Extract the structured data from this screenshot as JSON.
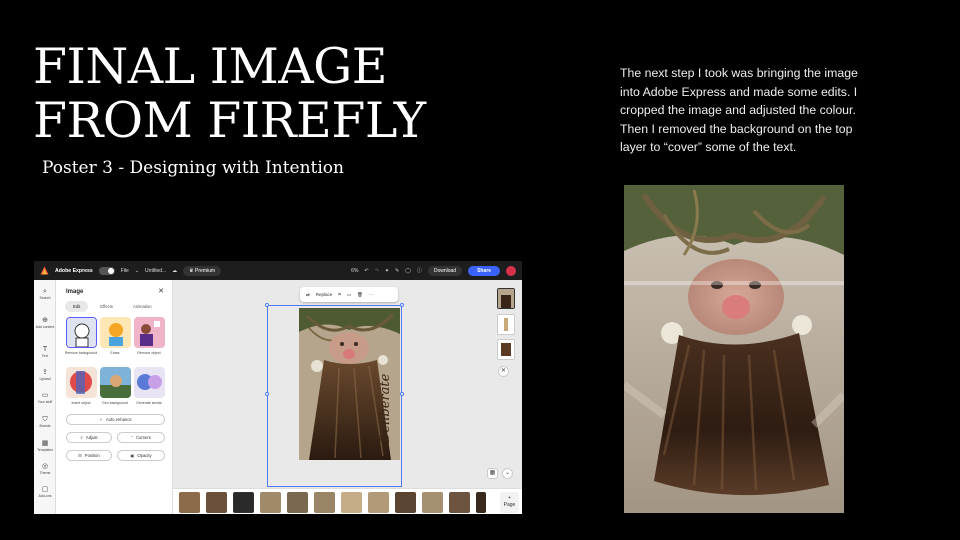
{
  "slide": {
    "title": "FINAL IMAGE FROM FIREFLY",
    "subtitle": "Poster 3 - Designing with Intention",
    "description": "The next step I took was bringing the image into Adobe Express and made some edits. I cropped the image and adjusted the colour. Then I removed the background on the top layer to “cover” some of the text."
  },
  "adobe_express": {
    "topbar": {
      "brand": "Adobe Express",
      "file_menu": "File",
      "doc_name": "Untitled...",
      "premium": "Premium",
      "zoom": "6%",
      "download": "Download",
      "share": "Share"
    },
    "rail": [
      {
        "label": "Search",
        "icon": "search-icon"
      },
      {
        "label": "Add content",
        "icon": "add-icon"
      },
      {
        "label": "Text",
        "icon": "text-icon"
      },
      {
        "label": "Upload",
        "icon": "upload-icon"
      },
      {
        "label": "Your stuff",
        "icon": "folder-icon"
      },
      {
        "label": "Brands",
        "icon": "brand-icon"
      },
      {
        "label": "Templates",
        "icon": "templates-icon"
      },
      {
        "label": "Theme",
        "icon": "theme-icon"
      },
      {
        "label": "Add-ons",
        "icon": "addons-icon"
      }
    ],
    "panel": {
      "title": "Image",
      "tabs": [
        "Edit",
        "Effects",
        "Animation"
      ],
      "tools": [
        "Remove background",
        "Erase",
        "Remove object",
        "Insert object",
        "Gen background",
        "Generate similar"
      ],
      "auto_enhance": "Auto enhance",
      "adjust": "Adjust",
      "corners": "Corners",
      "position": "Position",
      "opacity": "Opacity"
    },
    "canvas": {
      "toolbar_replace": "Replace",
      "poster_text": "Deliberate"
    },
    "filmstrip": {
      "add_page": "Page"
    }
  }
}
